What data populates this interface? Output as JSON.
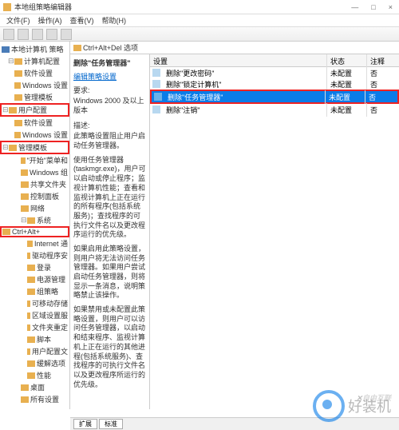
{
  "titlebar": {
    "title": "本地组策略编辑器"
  },
  "menubar": {
    "file": "文件(F)",
    "action": "操作(A)",
    "view": "查看(V)",
    "help": "帮助(H)"
  },
  "tree": {
    "root": "本地计算机 策略",
    "computer_config": "计算机配置",
    "software_settings": "软件设置",
    "windows_settings": "Windows 设置",
    "admin_templates": "管理模板",
    "user_config": "用户配置",
    "software_settings2": "软件设置",
    "windows_settings2": "Windows 设置",
    "admin_templates2": "管理模板",
    "start_menu": "\"开始\"菜单和",
    "windows_comp": "Windows 组",
    "shared_folder": "共享文件夹",
    "control_panel": "控制面板",
    "network": "网络",
    "system": "系统",
    "ctrl_alt_del": "Ctrl+Alt+",
    "internet": "Internet 通",
    "driver_install": "驱动程序安",
    "login": "登录",
    "power_mgmt": "电源管理",
    "group_policy": "组策略",
    "removable_storage": "可移动存储",
    "locale_service": "区域设置服",
    "folder_redirect": "文件夹重定",
    "scripts": "脚本",
    "user_profile": "用户配置文",
    "ctrl_alt_del2": "缓解选项",
    "performance": "性能",
    "desktop": "桌面",
    "all_settings": "所有设置"
  },
  "breadcrumb": "Ctrl+Alt+Del 选项",
  "detail": {
    "title": "删除\"任务管理器\"",
    "link": "编辑策略设置",
    "req_label": "要求:",
    "req_value": "Windows 2000 及以上版本",
    "desc_label": "描述:",
    "desc1": "此策略设置阻止用户启动任务管理器。",
    "desc2": "使用任务管理器(taskmgr.exe)，用户可以启动或停止程序；监视计算机性能；查看和监视计算机上正在运行的所有程序(包括系统服务)；查找程序的可执行文件名以及更改程序运行的优先级。",
    "desc3": "如果启用此策略设置，则用户将无法访问任务管理器。如果用户尝试启动任务管理器，则将显示一条消息，说明策略禁止该操作。",
    "desc4": "如果禁用或未配置此策略设置，则用户可以访问任务管理器，以启动和结束程序、监视计算机上正在运行的其他进程(包括系统服务)、查找程序的可执行文件名以及更改程序所运行的优先级。"
  },
  "list": {
    "header": {
      "setting": "设置",
      "state": "状态",
      "comment": "注释"
    },
    "rows": [
      {
        "name": "删除\"更改密码\"",
        "state": "未配置",
        "comment": "否"
      },
      {
        "name": "删除\"锁定计算机\"",
        "state": "未配置",
        "comment": "否"
      },
      {
        "name": "删除\"任务管理器\"",
        "state": "未配置",
        "comment": "否",
        "selected": true
      },
      {
        "name": "删除\"注销\"",
        "state": "未配置",
        "comment": "否"
      }
    ]
  },
  "statusbar": {
    "tab1": "扩展",
    "tab2": "标准"
  },
  "watermark": "自由互联",
  "watermark2": "好装机"
}
